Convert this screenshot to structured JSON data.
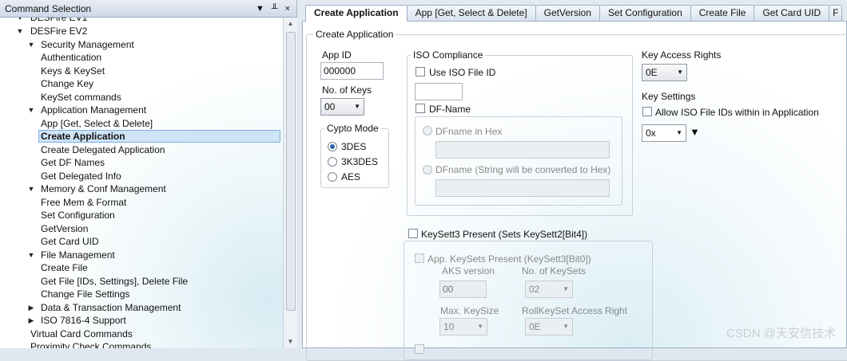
{
  "left_panel": {
    "title": "Command Selection",
    "header_buttons": [
      "▼",
      "╨",
      "×"
    ],
    "tree": [
      {
        "label": "DESFire EV1",
        "level": 1,
        "toggle": "expanded",
        "partial": true
      },
      {
        "label": "DESFire EV2",
        "level": 1,
        "toggle": "expanded"
      },
      {
        "label": "Security Management",
        "level": 2,
        "toggle": "expanded"
      },
      {
        "label": "Authentication",
        "level": 3
      },
      {
        "label": "Keys & KeySet",
        "level": 3
      },
      {
        "label": "Change Key",
        "level": 3
      },
      {
        "label": "KeySet commands",
        "level": 3
      },
      {
        "label": "Application Management",
        "level": 2,
        "toggle": "expanded"
      },
      {
        "label": "App [Get, Select & Delete]",
        "level": 3
      },
      {
        "label": "Create Application",
        "level": 3,
        "selected": true
      },
      {
        "label": "Create Delegated Application",
        "level": 3
      },
      {
        "label": "Get DF Names",
        "level": 3
      },
      {
        "label": "Get Delegated Info",
        "level": 3
      },
      {
        "label": "Memory & Conf Management",
        "level": 2,
        "toggle": "expanded"
      },
      {
        "label": "Free Mem & Format",
        "level": 3
      },
      {
        "label": "Set Configuration",
        "level": 3
      },
      {
        "label": "GetVersion",
        "level": 3
      },
      {
        "label": "Get Card UID",
        "level": 3
      },
      {
        "label": "File Management",
        "level": 2,
        "toggle": "expanded"
      },
      {
        "label": "Create File",
        "level": 3
      },
      {
        "label": "Get File [IDs, Settings], Delete File",
        "level": 3
      },
      {
        "label": "Change File Settings",
        "level": 3
      },
      {
        "label": "Data & Transaction Management",
        "level": 2,
        "toggle": "collapsed"
      },
      {
        "label": "ISO 7816-4 Support",
        "level": 2,
        "toggle": "collapsed"
      },
      {
        "label": "Virtual Card Commands",
        "level": 1
      },
      {
        "label": "Proximity Check Commands",
        "level": 1,
        "partial": true
      }
    ]
  },
  "tabs": [
    "Create Application",
    "App [Get, Select & Delete]",
    "GetVersion",
    "Set Configuration",
    "Create File",
    "Get Card UID",
    "F"
  ],
  "form": {
    "group_title": "Create Application",
    "app_id_label": "App ID",
    "app_id_value": "000000",
    "num_keys_label": "No. of Keys",
    "num_keys_value": "00",
    "crypto_title": "Cypto Mode",
    "crypto_options": [
      "3DES",
      "3K3DES",
      "AES"
    ],
    "crypto_selected": "3DES",
    "iso_title": "ISO Compliance",
    "use_iso_file_id": "Use ISO File ID",
    "df_name": "DF-Name",
    "dfname_hex": "DFname in Hex",
    "dfname_string": "DFname (String will be converted to Hex)",
    "key_access_rights_label": "Key Access Rights",
    "key_access_rights_value": "0E",
    "key_settings_label": "Key Settings",
    "allow_iso_file_ids": "Allow ISO File IDs within in Application",
    "key_settings_value": "0x",
    "keysett3_present": "KeySett3 Present (Sets KeySett2[Bit4])",
    "app_keysets_present": "App. KeySets Present (KeySett3[Bit0])",
    "aks_version_label": "AKS version",
    "aks_version_value": "00",
    "num_keysets_label": "No. of KeySets",
    "num_keysets_value": "02",
    "max_keysize_label": "Max. KeySize",
    "max_keysize_value": "10",
    "rollkeyset_label": "RollKeySet Access Right",
    "rollkeyset_value": "0E"
  },
  "watermark": "CSDN @天安信技术",
  "colors": {
    "selection": "#cfe3f7",
    "header": "#cdd9e7",
    "panel_bg": "#e2e9f1"
  }
}
